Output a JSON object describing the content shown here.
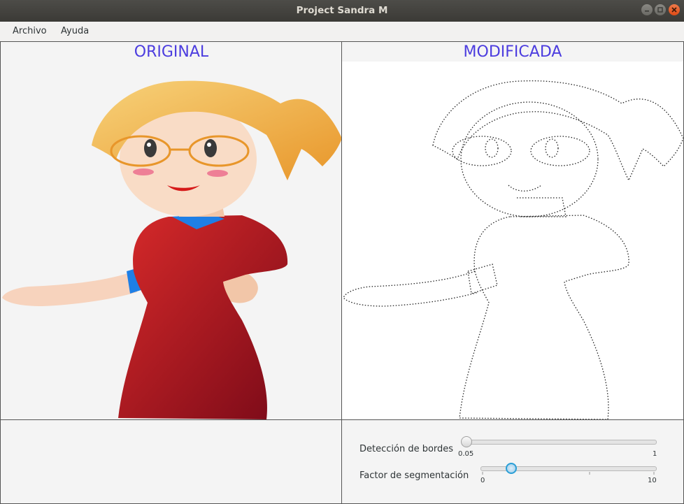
{
  "window": {
    "title": "Project Sandra M"
  },
  "menu": {
    "items": [
      "Archivo",
      "Ayuda"
    ]
  },
  "panels": {
    "original": {
      "title": "ORIGINAL"
    },
    "modified": {
      "title": "MODIFICADA"
    }
  },
  "controls": {
    "edge_detection": {
      "label": "Detección de bordes",
      "min": "0.05",
      "max": "1",
      "value": 0.05
    },
    "segmentation": {
      "label": "Factor de segmentación",
      "min": "0",
      "max": "10",
      "value": 1.75
    }
  },
  "icons": {
    "minimize": "minimize-icon",
    "maximize": "maximize-icon",
    "close": "close-icon"
  },
  "colors": {
    "panel_title": "#4c3ddf",
    "close_button": "#df4b16",
    "slider_accent": "#2a9fd6"
  }
}
